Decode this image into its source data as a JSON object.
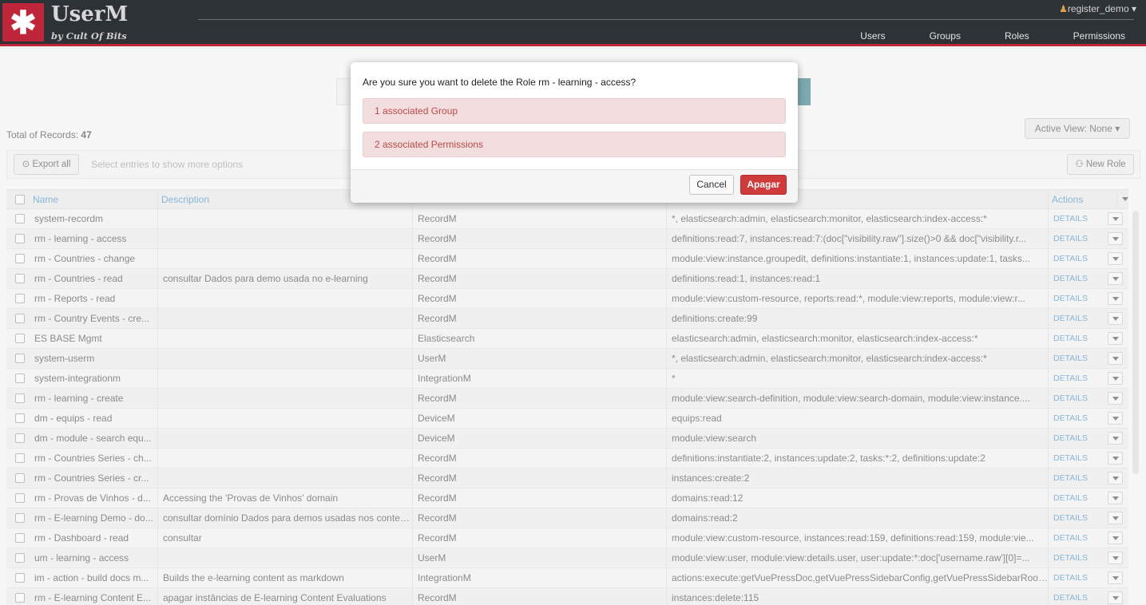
{
  "header": {
    "logo_glyph": "✱",
    "title": "UserM",
    "subtitle": "by Cult Of Bits",
    "user": "register_demo",
    "nav": [
      "Users",
      "Groups",
      "Roles",
      "Permissions"
    ]
  },
  "toolbar": {
    "total_label": "Total of Records:",
    "total_count": "47",
    "active_view": "Active View: None",
    "export_label": "Export all",
    "hint": "Select entries to show more options",
    "new_role_label": "New Role"
  },
  "table": {
    "columns": [
      "Name",
      "Description",
      "",
      "",
      "Actions"
    ],
    "details_label": "DETAILS",
    "rows": [
      {
        "name": "system-recordm",
        "description": "",
        "product": "RecordM",
        "permissions": "*, elasticsearch:admin, elasticsearch:monitor, elasticsearch:index-access:*"
      },
      {
        "name": "rm - learning - access",
        "description": "",
        "product": "RecordM",
        "permissions": "definitions:read:7, instances:read:7:(doc[\"visibility.raw\"].size()>0 && doc[\"visibility.r..."
      },
      {
        "name": "rm - Countries - change",
        "description": "",
        "product": "RecordM",
        "permissions": "module:view:instance.groupedit, definitions:instantiate:1, instances:update:1, tasks..."
      },
      {
        "name": "rm - Countries - read",
        "description": "consultar Dados para demo usada no e-learning",
        "product": "RecordM",
        "permissions": "definitions:read:1, instances:read:1"
      },
      {
        "name": "rm - Reports - read",
        "description": "",
        "product": "RecordM",
        "permissions": "module:view:custom-resource, reports:read:*, module:view:reports, module:view:r..."
      },
      {
        "name": "rm - Country Events - cre...",
        "description": "",
        "product": "RecordM",
        "permissions": "definitions:create:99"
      },
      {
        "name": "ES BASE Mgmt",
        "description": "",
        "product": "Elasticsearch",
        "permissions": "elasticsearch:admin, elasticsearch:monitor, elasticsearch:index-access:*"
      },
      {
        "name": "system-userm",
        "description": "",
        "product": "UserM",
        "permissions": "*, elasticsearch:admin, elasticsearch:monitor, elasticsearch:index-access:*"
      },
      {
        "name": "system-integrationm",
        "description": "",
        "product": "IntegrationM",
        "permissions": "*"
      },
      {
        "name": "rm - learning - create",
        "description": "",
        "product": "RecordM",
        "permissions": "module:view:search-definition, module:view:search-domain, module:view:instance...."
      },
      {
        "name": "dm - equips - read",
        "description": "",
        "product": "DeviceM",
        "permissions": "equips:read"
      },
      {
        "name": "dm - module - search equ...",
        "description": "",
        "product": "DeviceM",
        "permissions": "module:view:search"
      },
      {
        "name": "rm - Countries Series - ch...",
        "description": "",
        "product": "RecordM",
        "permissions": "definitions:instantiate:2, instances:update:2, tasks:*:2, definitions:update:2"
      },
      {
        "name": "rm - Countries Series - cr...",
        "description": "",
        "product": "RecordM",
        "permissions": "instances:create:2"
      },
      {
        "name": "rm - Provas de Vinhos - d...",
        "description": "Accessing the 'Provas de Vinhos' domain",
        "product": "RecordM",
        "permissions": "domains:read:12"
      },
      {
        "name": "rm - E-learning Demo - do...",
        "description": "consultar domínio Dados para demos usadas nos conteú...",
        "product": "RecordM",
        "permissions": "domains:read:2"
      },
      {
        "name": "rm - Dashboard - read",
        "description": "consultar",
        "product": "RecordM",
        "permissions": "module:view:custom-resource, instances:read:159, definitions:read:159, module:vie..."
      },
      {
        "name": "um - learning - access",
        "description": "",
        "product": "UserM",
        "permissions": "module:view:user, module:view:details.user, user:update:*:doc['username.raw'][0]=..."
      },
      {
        "name": "im - action - build docs m...",
        "description": "Builds the e-learning content as markdown",
        "product": "IntegrationM",
        "permissions": "actions:execute:getVuePressDoc,getVuePressSidebarConfig,getVuePressSidebarRootEl..."
      },
      {
        "name": "rm - E-learning Content E...",
        "description": "apagar instâncias de E-learning Content Evaluations",
        "product": "RecordM",
        "permissions": "instances:delete:115"
      }
    ]
  },
  "modal": {
    "question": "Are you sure you want to delete the Role rm - learning - access?",
    "alert_groups": "1 associated Group",
    "alert_permissions": "2 associated Permissions",
    "cancel_label": "Cancel",
    "confirm_label": "Apagar"
  },
  "colors": {
    "brand_red": "#c0263a",
    "header_bg": "#2c3236",
    "link_blue": "#2a78b5",
    "danger": "#cf3a3a"
  }
}
